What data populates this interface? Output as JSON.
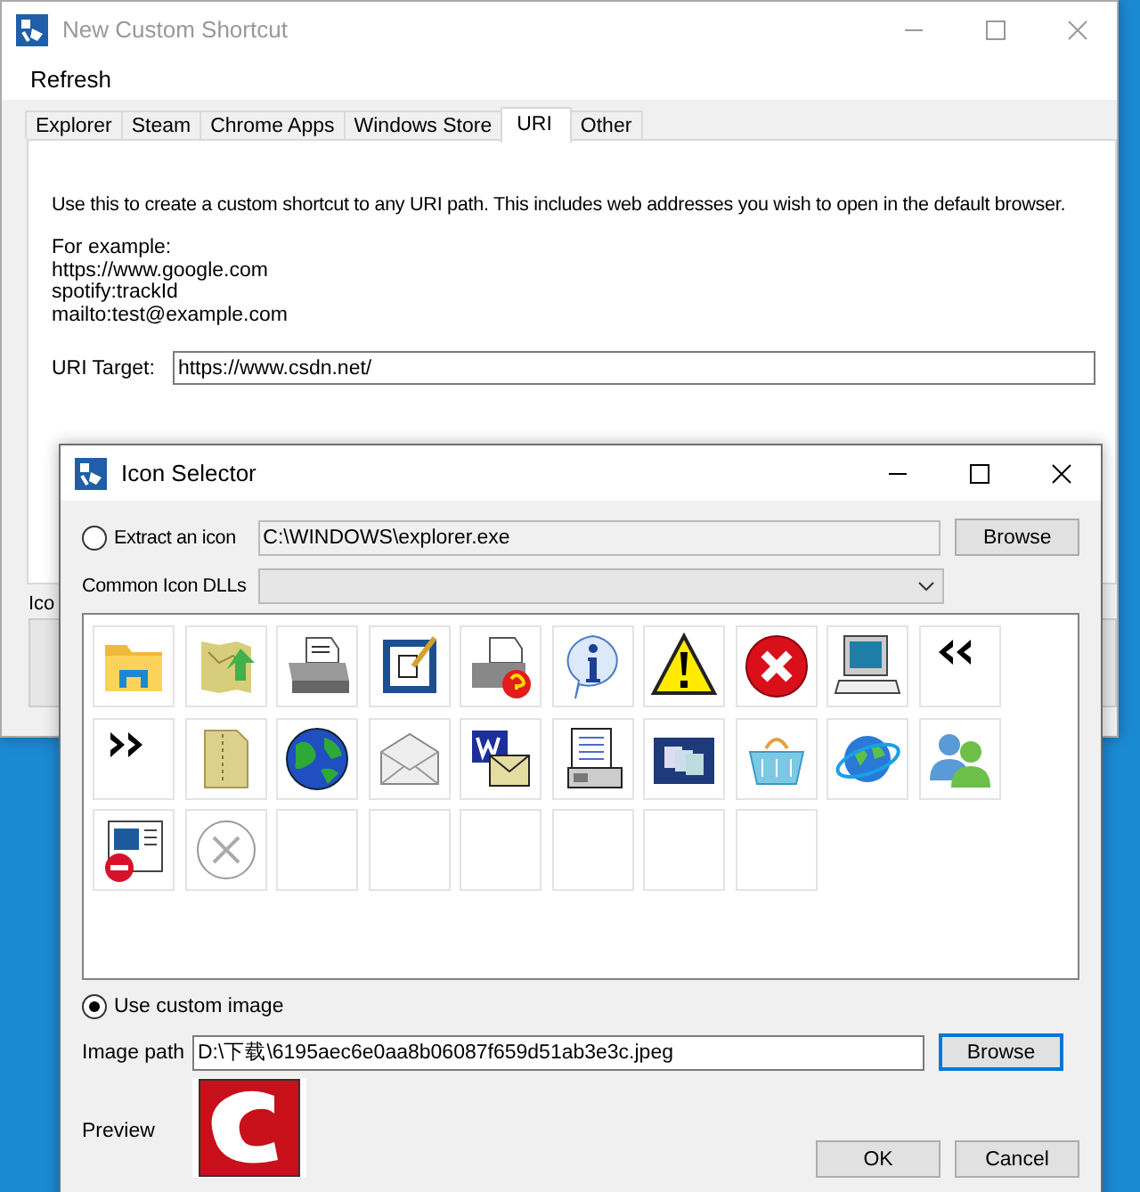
{
  "background_window": {
    "title": "New Custom Shortcut",
    "menu": [
      "Refresh"
    ],
    "tabs": [
      {
        "label": "Explorer",
        "selected": false
      },
      {
        "label": "Steam",
        "selected": false
      },
      {
        "label": "Chrome Apps",
        "selected": false
      },
      {
        "label": "Windows Store",
        "selected": false
      },
      {
        "label": "URI",
        "selected": true
      },
      {
        "label": "Other",
        "selected": false
      }
    ],
    "description": "Use this to create a custom shortcut to any URI path. This includes web addresses you wish to open in the default browser.",
    "examples_heading": "For example:",
    "examples": [
      "https://www.google.com",
      "spotify:trackId",
      "mailto:test@example.com"
    ],
    "uri_target": {
      "label": "URI Target:",
      "value": "https://www.csdn.net/"
    },
    "icon_label": "Ico"
  },
  "icon_selector": {
    "title": "Icon Selector",
    "extract": {
      "label": "Extract an icon",
      "selected": false,
      "value": "C:\\WINDOWS\\explorer.exe",
      "button": {
        "label": "Browse",
        "focused": false
      }
    },
    "dlls": {
      "label": "Common Icon DLLs"
    },
    "custom": {
      "label": "Use custom image",
      "selected": true
    },
    "image_path": {
      "label": "Image path",
      "value": "D:\\下载\\6195aec6e0aa8b06087f659d51ab3e3c.jpeg",
      "button": {
        "label": "Browse",
        "focused": true
      }
    },
    "preview_label": "Preview",
    "buttons": [
      "OK",
      "Cancel"
    ]
  }
}
